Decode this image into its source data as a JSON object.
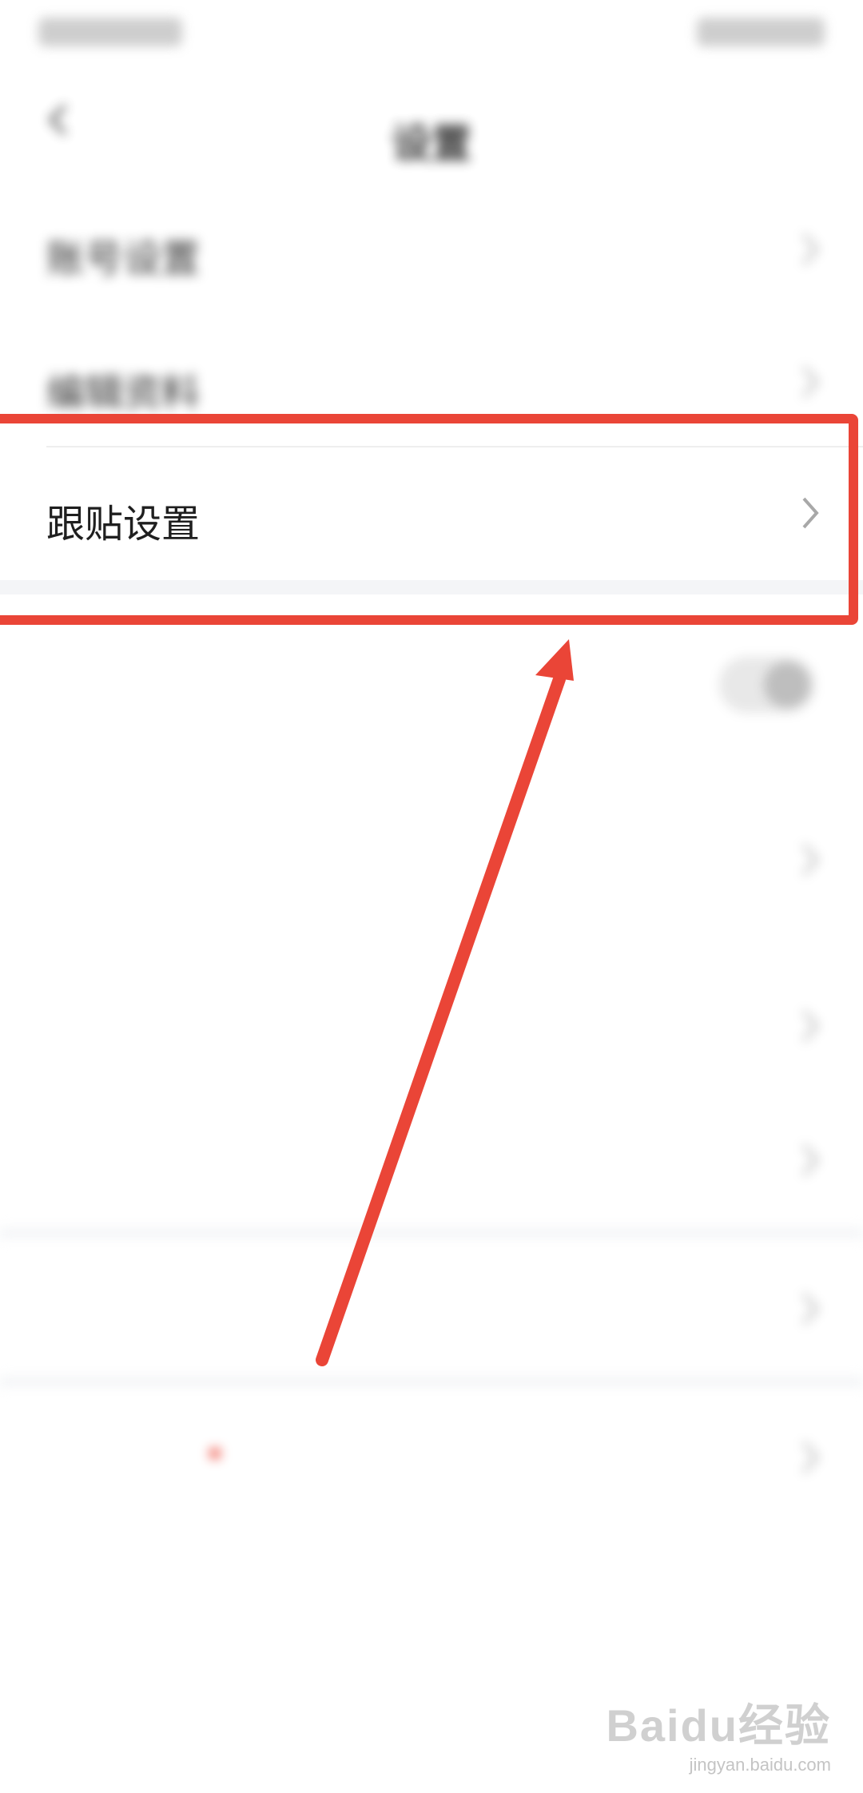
{
  "status_bar": {
    "left_text": "",
    "right_text": ""
  },
  "nav": {
    "title": "设置",
    "back_icon": "chevron-left-icon"
  },
  "rows": {
    "account": {
      "label": "账号设置"
    },
    "profile": {
      "label": "编辑资料"
    },
    "follow_post": {
      "label": "跟贴设置"
    },
    "privacy": {
      "label": "",
      "sub": ""
    },
    "reading": {
      "label": "",
      "sub": ""
    },
    "comment": {
      "label": ""
    },
    "offline": {
      "label": "",
      "value": ""
    },
    "network": {
      "label": ""
    },
    "update": {
      "label": "",
      "value": ""
    },
    "cache": {
      "label": "",
      "value": ""
    },
    "about": {
      "label": ""
    }
  },
  "colors": {
    "annotation_red": "#ea4537",
    "chevron": "#b0b0b0",
    "section_gap": "#f4f5f7"
  },
  "annotation": {
    "highlight": "red-rectangle",
    "arrow": "red-arrow-pointing-up"
  },
  "watermark": {
    "brand": "Baidu经验",
    "url": "jingyan.baidu.com"
  }
}
